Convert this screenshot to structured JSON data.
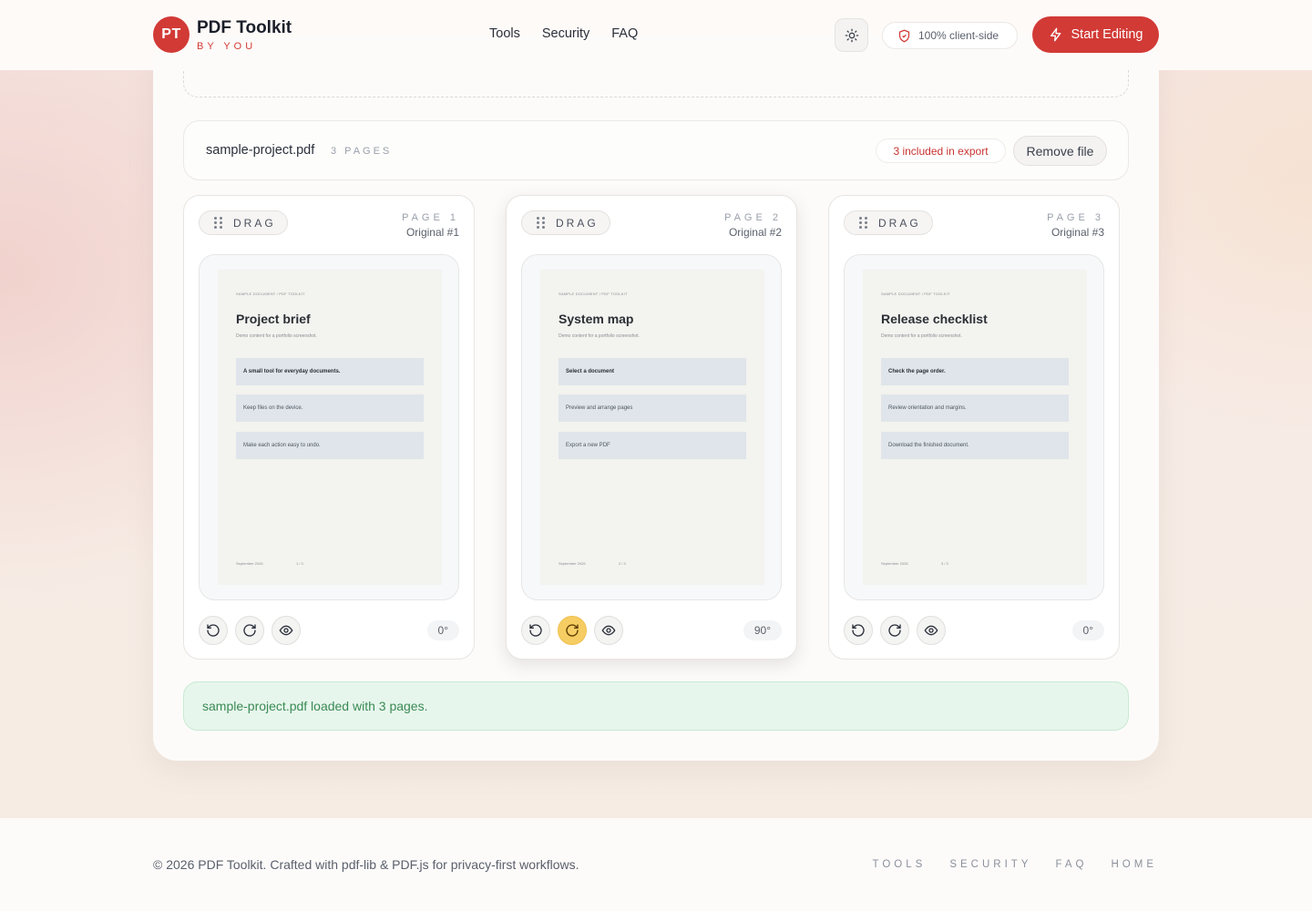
{
  "header": {
    "logo_initials": "PT",
    "brand_name": "PDF Toolkit",
    "brand_sub": "BY YOU",
    "nav": [
      "Tools",
      "Security",
      "FAQ"
    ],
    "client_side_label": "100% client-side",
    "start_label": "Start Editing"
  },
  "file": {
    "name": "sample-project.pdf",
    "pages_label": "3 PAGES",
    "export_label": "3 included in export",
    "remove_label": "Remove file"
  },
  "cards": [
    {
      "drag_label": "DRAG",
      "page_label": "PAGE 1",
      "original_label": "Original #1",
      "thumb": {
        "header": "SAMPLE DOCUMENT / PDF TOOLKIT",
        "title": "Project brief",
        "subtitle": "Demo content for a portfolio screenshot.",
        "rows": [
          "A small tool for everyday documents.",
          "Keep files on the device.",
          "Make each action easy to undo."
        ],
        "footer_left": "September 2026",
        "footer_right": "1 / 3"
      },
      "angle": "0°"
    },
    {
      "drag_label": "DRAG",
      "page_label": "PAGE 2",
      "original_label": "Original #2",
      "thumb": {
        "header": "SAMPLE DOCUMENT / PDF TOOLKIT",
        "title": "System map",
        "subtitle": "Demo content for a portfolio screenshot.",
        "rows": [
          "Select a document",
          "Preview and arrange pages",
          "Export a new PDF"
        ],
        "footer_left": "September 2026",
        "footer_right": "2 / 3"
      },
      "angle": "90°"
    },
    {
      "drag_label": "DRAG",
      "page_label": "PAGE 3",
      "original_label": "Original #3",
      "thumb": {
        "header": "SAMPLE DOCUMENT / PDF TOOLKIT",
        "title": "Release checklist",
        "subtitle": "Demo content for a portfolio screenshot.",
        "rows": [
          "Check the page order.",
          "Review orientation and margins.",
          "Download the finished document."
        ],
        "footer_left": "September 2026",
        "footer_right": "3 / 3"
      },
      "angle": "0°"
    }
  ],
  "status_message": "sample-project.pdf loaded with 3 pages.",
  "footer": {
    "copyright": "© 2026 PDF Toolkit. Crafted with pdf-lib & PDF.js for privacy-first workflows.",
    "links": [
      "TOOLS",
      "SECURITY",
      "FAQ",
      "HOME"
    ]
  },
  "colors": {
    "accent": "#d23a36",
    "highlight": "#f6cd63",
    "success_bg": "#e7f6ec",
    "success_text": "#3a8a55"
  },
  "icons": {
    "theme": "sun-icon",
    "client_side": "shield-icon",
    "start": "lightning-icon",
    "drag": "drag-handle-icon",
    "rotate_left": "rotate-left-icon",
    "rotate_right": "rotate-right-icon",
    "preview": "eye-icon"
  }
}
